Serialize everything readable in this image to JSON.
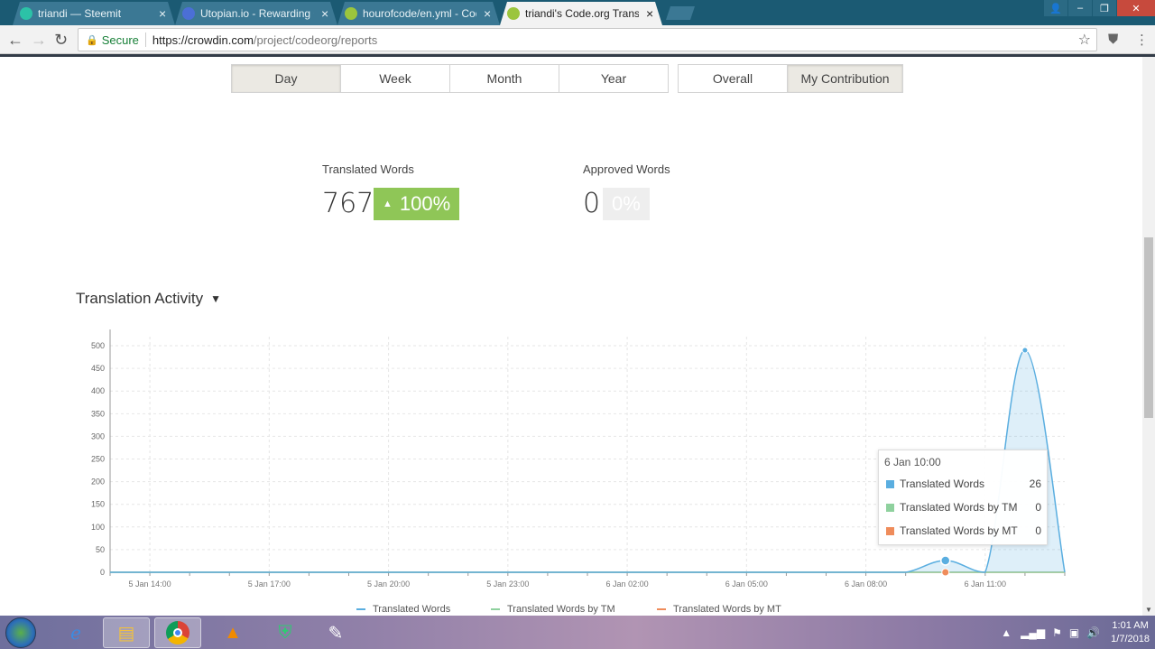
{
  "browser": {
    "tabs": [
      {
        "title": "triandi — Steemit",
        "color": "#2cc2a7"
      },
      {
        "title": "Utopian.io - Rewarding O",
        "color": "#4b6fd6"
      },
      {
        "title": "hourofcode/en.yml - Cod",
        "color": "#9bc53d"
      },
      {
        "title": "triandi's Code.org Transla",
        "color": "#9bc53d"
      }
    ],
    "secure_label": "Secure",
    "url_host": "https://crowdin.com",
    "url_path": "/project/codeorg/reports"
  },
  "filters": {
    "period": [
      "Day",
      "Week",
      "Month",
      "Year"
    ],
    "scope": [
      "Overall",
      "My Contribution"
    ],
    "active_period": "Day",
    "active_scope": "My Contribution"
  },
  "stats": {
    "translated": {
      "label": "Translated Words",
      "value": "767",
      "change": "100%"
    },
    "approved": {
      "label": "Approved Words",
      "value": "0",
      "change": "0%"
    }
  },
  "section_title": "Translation Activity",
  "chart_data": {
    "type": "area",
    "x": [
      "5 Jan 13:00",
      "5 Jan 14:00",
      "5 Jan 15:00",
      "5 Jan 16:00",
      "5 Jan 17:00",
      "5 Jan 18:00",
      "5 Jan 19:00",
      "5 Jan 20:00",
      "5 Jan 21:00",
      "5 Jan 22:00",
      "5 Jan 23:00",
      "6 Jan 00:00",
      "6 Jan 01:00",
      "6 Jan 02:00",
      "6 Jan 03:00",
      "6 Jan 04:00",
      "6 Jan 05:00",
      "6 Jan 06:00",
      "6 Jan 07:00",
      "6 Jan 08:00",
      "6 Jan 09:00",
      "6 Jan 10:00",
      "6 Jan 11:00",
      "6 Jan 12:00",
      "6 Jan 13:00"
    ],
    "x_tick_labels": [
      "5 Jan 14:00",
      "5 Jan 17:00",
      "5 Jan 20:00",
      "5 Jan 23:00",
      "6 Jan 02:00",
      "6 Jan 05:00",
      "6 Jan 08:00",
      "6 Jan 11:00"
    ],
    "series": [
      {
        "name": "Translated Words",
        "color": "#5aaee0",
        "values": [
          0,
          0,
          0,
          0,
          0,
          0,
          0,
          0,
          0,
          0,
          0,
          0,
          0,
          0,
          0,
          0,
          0,
          0,
          0,
          0,
          0,
          26,
          0,
          490,
          0
        ]
      },
      {
        "name": "Translated Words by TM",
        "color": "#8fd19e",
        "values": [
          0,
          0,
          0,
          0,
          0,
          0,
          0,
          0,
          0,
          0,
          0,
          0,
          0,
          0,
          0,
          0,
          0,
          0,
          0,
          0,
          0,
          0,
          0,
          0,
          0
        ]
      },
      {
        "name": "Translated Words by MT",
        "color": "#ef8c5b",
        "values": [
          0,
          0,
          0,
          0,
          0,
          0,
          0,
          0,
          0,
          0,
          0,
          0,
          0,
          0,
          0,
          0,
          0,
          0,
          0,
          0,
          0,
          0,
          0,
          0,
          0
        ]
      }
    ],
    "y_ticks": [
      0,
      50,
      100,
      150,
      200,
      250,
      300,
      350,
      400,
      450,
      500
    ],
    "ylim": [
      0,
      520
    ],
    "grid": true,
    "legend": "bottom"
  },
  "tooltip": {
    "title": "6 Jan 10:00",
    "rows": [
      {
        "name": "Translated Words",
        "value": "26",
        "color": "#5aaee0"
      },
      {
        "name": "Translated Words by TM",
        "value": "0",
        "color": "#8fd19e"
      },
      {
        "name": "Translated Words by MT",
        "value": "0",
        "color": "#ef8c5b"
      }
    ]
  },
  "taskbar": {
    "time": "1:01 AM",
    "date": "1/7/2018"
  }
}
